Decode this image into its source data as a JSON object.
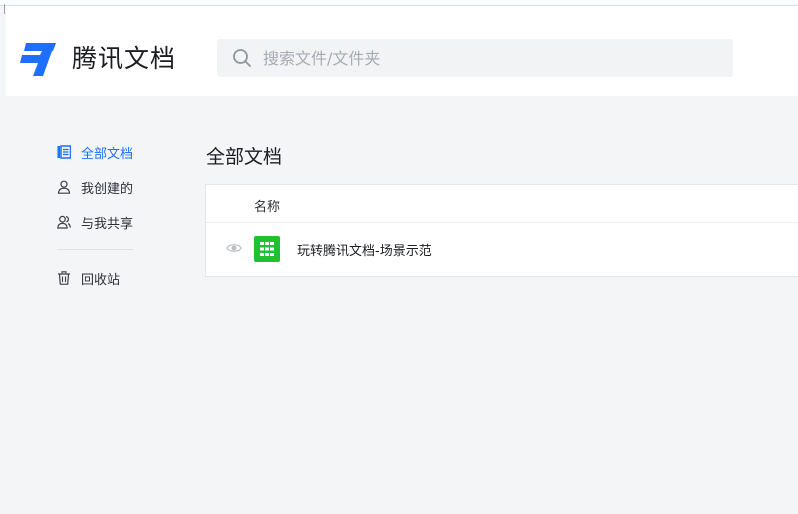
{
  "brand": {
    "name": "腾讯文档",
    "logo_color": "#1e6fff"
  },
  "search": {
    "placeholder": "搜索文件/文件夹",
    "icon": "search-icon"
  },
  "sidebar": {
    "items": [
      {
        "label": "全部文档",
        "icon": "document-list-icon",
        "active": true
      },
      {
        "label": "我创建的",
        "icon": "user-icon",
        "active": false
      },
      {
        "label": "与我共享",
        "icon": "shared-users-icon",
        "active": false
      },
      {
        "label": "回收站",
        "icon": "trash-icon",
        "active": false
      }
    ]
  },
  "main": {
    "title": "全部文档",
    "columns": {
      "name": "名称"
    },
    "documents": [
      {
        "title": "玩转腾讯文档-场景示范",
        "type_icon": "spreadsheet-icon",
        "status_icon": "eye-icon",
        "type_color": "#1fc12e"
      }
    ]
  },
  "colors": {
    "accent": "#1e6fff",
    "background": "#f4f5f7"
  }
}
